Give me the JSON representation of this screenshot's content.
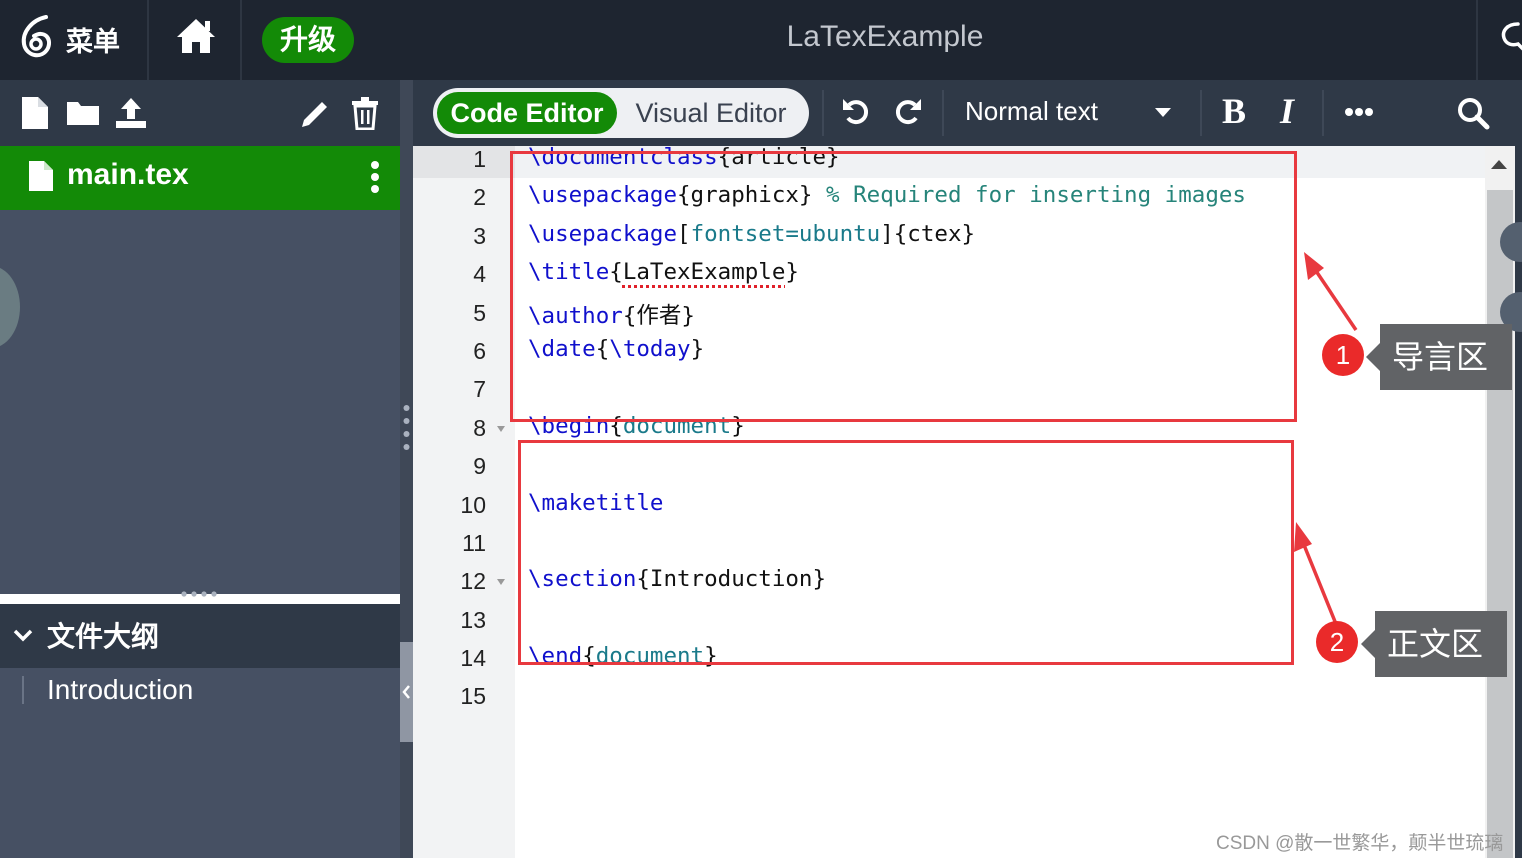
{
  "topbar": {
    "menu_label": "菜单",
    "upgrade_label": "升级",
    "project_title": "LaTexExample"
  },
  "editor_toolbar": {
    "code_editor_label": "Code Editor",
    "visual_editor_label": "Visual Editor",
    "format_value": "Normal text",
    "bold_label": "B",
    "italic_label": "I"
  },
  "file_tree": {
    "files": [
      {
        "name": "main.tex",
        "selected": true
      }
    ]
  },
  "outline": {
    "title": "文件大纲",
    "items": [
      "Introduction"
    ]
  },
  "editor": {
    "line_numbers": [
      "1",
      "2",
      "3",
      "4",
      "5",
      "6",
      "7",
      "8",
      "9",
      "10",
      "11",
      "12",
      "13",
      "14",
      "15"
    ],
    "lines": {
      "l1": {
        "cmd": "\\documentclass",
        "rest": "{article}"
      },
      "l2": {
        "cmd": "\\usepackage",
        "rest": "{graphicx} ",
        "comment": "% Required for inserting images"
      },
      "l3": {
        "cmd": "\\usepackage",
        "open": "[",
        "arg": "fontset=ubuntu",
        "rest": "]{ctex}"
      },
      "l4": {
        "cmd": "\\title",
        "open": "{",
        "arg": "LaTexExample",
        "close": "}"
      },
      "l5": {
        "cmd": "\\author",
        "rest": "{作者}"
      },
      "l6": {
        "cmd": "\\date",
        "open": "{",
        "arg": "\\today",
        "close": "}"
      },
      "l8": {
        "cmd": "\\begin",
        "open": "{",
        "arg": "document",
        "close": "}"
      },
      "l10": {
        "cmd": "\\maketitle"
      },
      "l12": {
        "cmd": "\\section",
        "rest": "{Introduction}"
      },
      "l14": {
        "cmd": "\\end",
        "open": "{",
        "arg": "document",
        "close": "}"
      }
    }
  },
  "annotations": [
    {
      "number": "1",
      "label": "导言区"
    },
    {
      "number": "2",
      "label": "正文区"
    }
  ],
  "watermark": "CSDN @散一世繁华，颠半世琉璃",
  "colors": {
    "brand_green": "#138a07",
    "dark_bg": "#1e2530",
    "panel_bg": "#465063",
    "annotation_red": "#e8393f"
  },
  "icons": [
    "overleaf-logo-icon",
    "home-icon",
    "chat-icon",
    "new-file-icon",
    "new-folder-icon",
    "upload-icon",
    "rename-icon",
    "delete-icon",
    "file-icon",
    "kebab-menu-icon",
    "chevron-down-icon",
    "undo-icon",
    "redo-icon",
    "caret-down-icon",
    "more-icon",
    "search-icon"
  ]
}
